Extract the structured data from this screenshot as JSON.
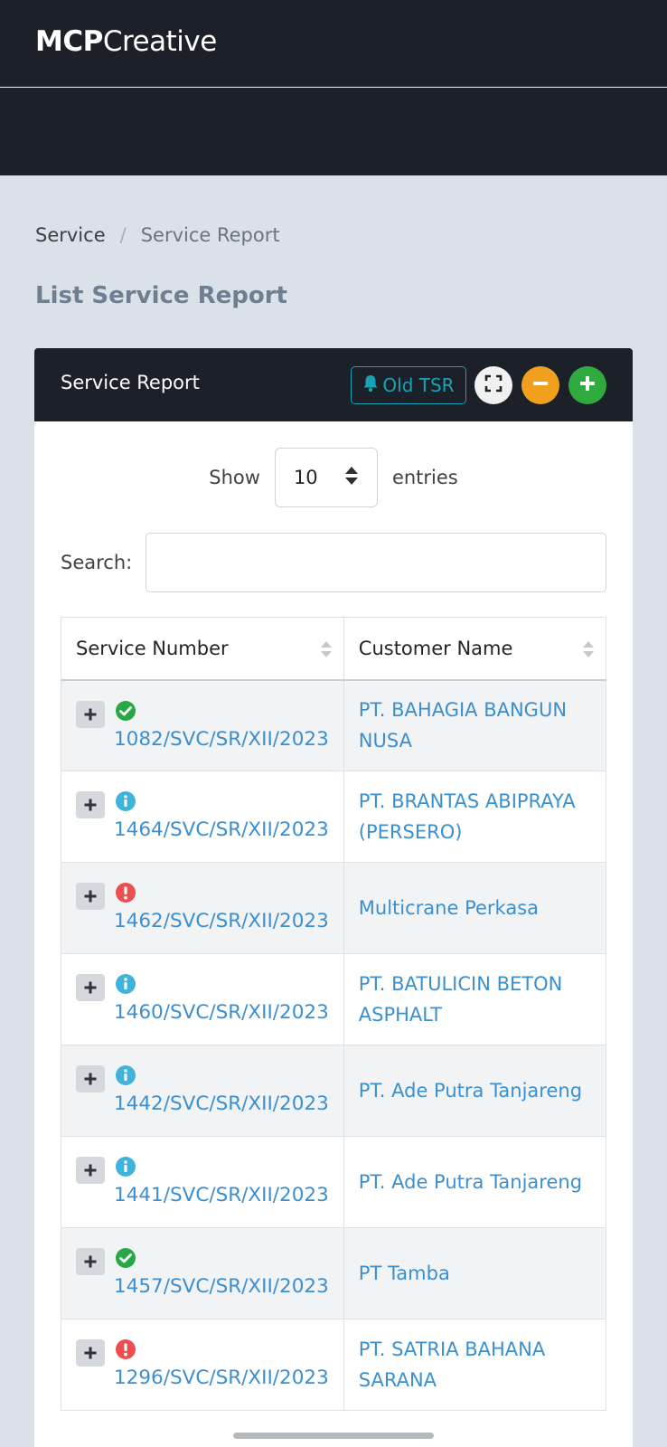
{
  "app": {
    "brand_bold": "MCP",
    "brand_light": "Creative"
  },
  "breadcrumb": {
    "items": [
      "Service",
      "Service Report"
    ],
    "separator": "/"
  },
  "page": {
    "title": "List Service Report"
  },
  "card": {
    "title": "Service Report",
    "old_tsr_label": "Old TSR",
    "tools": [
      "expand-icon",
      "minus-icon",
      "plus-icon"
    ]
  },
  "table_controls": {
    "show_label": "Show",
    "entries_value": "10",
    "entries_label": "entries",
    "search_label": "Search:",
    "search_value": ""
  },
  "table": {
    "columns": [
      "Service Number",
      "Customer Name"
    ],
    "rows": [
      {
        "status": "success",
        "service_number": "1082/SVC/SR/XII/2023",
        "customer": "PT. BAHAGIA BANGUN NUSA"
      },
      {
        "status": "info",
        "service_number": "1464/SVC/SR/XII/2023",
        "customer": "PT. BRANTAS ABIPRAYA (PERSERO)"
      },
      {
        "status": "warning",
        "service_number": "1462/SVC/SR/XII/2023",
        "customer": "Multicrane Perkasa"
      },
      {
        "status": "info",
        "service_number": "1460/SVC/SR/XII/2023",
        "customer": "PT. BATULICIN BETON ASPHALT"
      },
      {
        "status": "info",
        "service_number": "1442/SVC/SR/XII/2023",
        "customer": "PT. Ade Putra Tanjareng"
      },
      {
        "status": "info",
        "service_number": "1441/SVC/SR/XII/2023",
        "customer": "PT. Ade Putra Tanjareng"
      },
      {
        "status": "success",
        "service_number": "1457/SVC/SR/XII/2023",
        "customer": "PT Tamba"
      },
      {
        "status": "warning",
        "service_number": "1296/SVC/SR/XII/2023",
        "customer": "PT. SATRIA BAHANA SARANA"
      }
    ]
  },
  "colors": {
    "header_bg": "#1b2029",
    "link": "#3b8fcf",
    "success": "#28a745",
    "info": "#3fb3d9",
    "warning": "#ec4f4f",
    "accent_teal": "#17a2b8",
    "minus_orange": "#f0a01c",
    "plus_green": "#2faa3f"
  }
}
